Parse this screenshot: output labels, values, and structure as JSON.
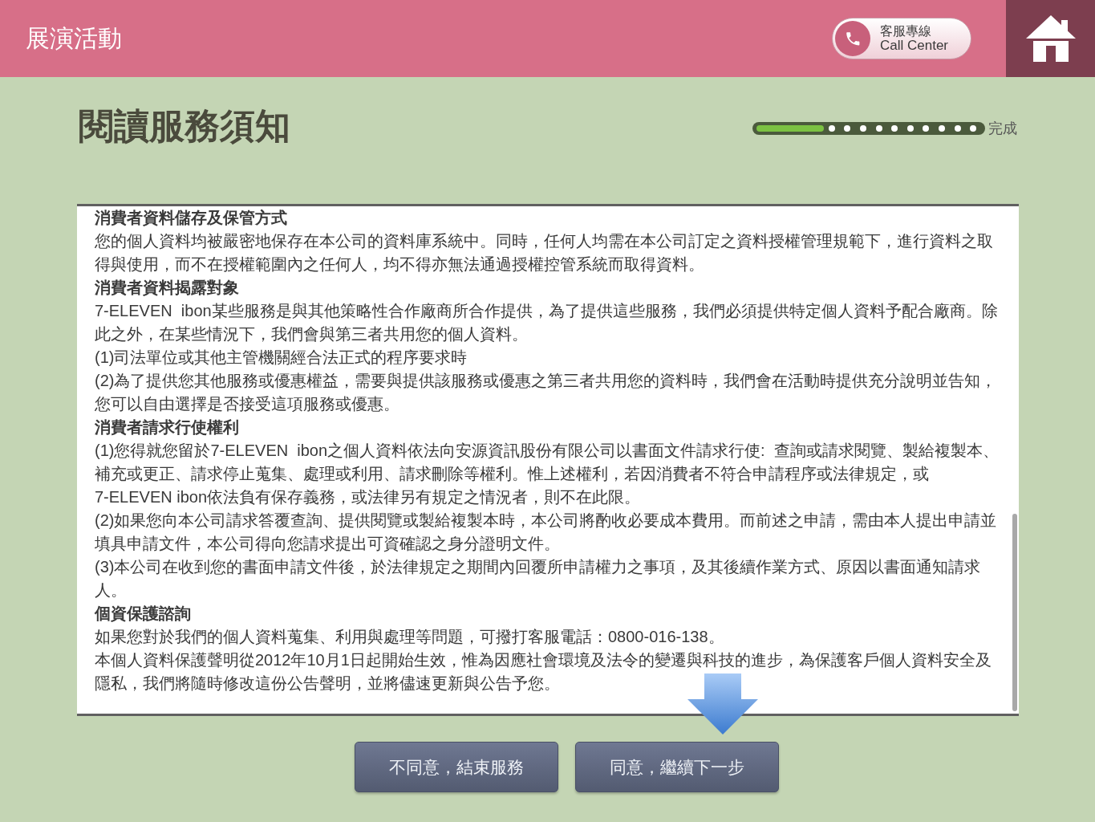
{
  "header": {
    "title": "展演活動",
    "call_center": {
      "label": "客服專線",
      "sublabel": "Call Center"
    }
  },
  "page": {
    "title": "閱讀服務須知",
    "progress": {
      "level": 0.3,
      "end_label": "完成"
    }
  },
  "notice": {
    "sections": [
      {
        "heading": "消費者資料儲存及保管方式",
        "paragraphs": [
          "您的個人資料均被嚴密地保存在本公司的資料庫系統中。同時，任何人均需在本公司訂定之資料授權管理規範下，進行資料之取得與使用，而不在授權範圍內之任何人，均不得亦無法通過授權控管系統而取得資料。"
        ]
      },
      {
        "heading": "消費者資料揭露對象",
        "paragraphs": [
          "7-ELEVEN  ibon某些服務是與其他策略性合作廠商所合作提供，為了提供這些服務，我們必須提供特定個人資料予配合廠商。除此之外，在某些情況下，我們會與第三者共用您的個人資料。",
          "(1)司法單位或其他主管機關經合法正式的程序要求時",
          "(2)為了提供您其他服務或優惠權益，需要與提供該服務或優惠之第三者共用您的資料時，我們會在活動時提供充分說明並告知，您可以自由選擇是否接受這項服務或優惠。"
        ]
      },
      {
        "heading": "消費者請求行使權利",
        "paragraphs": [
          "(1)您得就您留於7-ELEVEN  ibon之個人資料依法向安源資訊股份有限公司以書面文件請求行使:  查詢或請求閱覽、製給複製本、補充或更正、請求停止蒐集、處理或利用、請求刪除等權利。惟上述權利，若因消費者不符合申請程序或法律規定，或7-ELEVEN ibon依法負有保存義務，或法律另有規定之情況者，則不在此限。",
          "(2)如果您向本公司請求答覆查詢、提供閱覽或製給複製本時，本公司將酌收必要成本費用。而前述之申請，需由本人提出申請並填具申請文件，本公司得向您請求提出可資確認之身分證明文件。",
          "(3)本公司在收到您的書面申請文件後，於法律規定之期間內回覆所申請權力之事項，及其後續作業方式、原因以書面通知請求人。"
        ]
      },
      {
        "heading": "個資保護諮詢",
        "paragraphs": [
          "如果您對於我們的個人資料蒐集、利用與處理等問題，可撥打客服電話：0800-016-138。",
          "本個人資料保護聲明從2012年10月1日起開始生效，惟為因應社會環境及法令的變遷與科技的進步，為保護客戶個人資料安全及隱私，我們將隨時修改這份公告聲明，並將儘速更新與公告予您。"
        ]
      }
    ]
  },
  "buttons": [
    {
      "label": "不同意，結束服務"
    },
    {
      "label": "同意，繼續下一步"
    }
  ]
}
